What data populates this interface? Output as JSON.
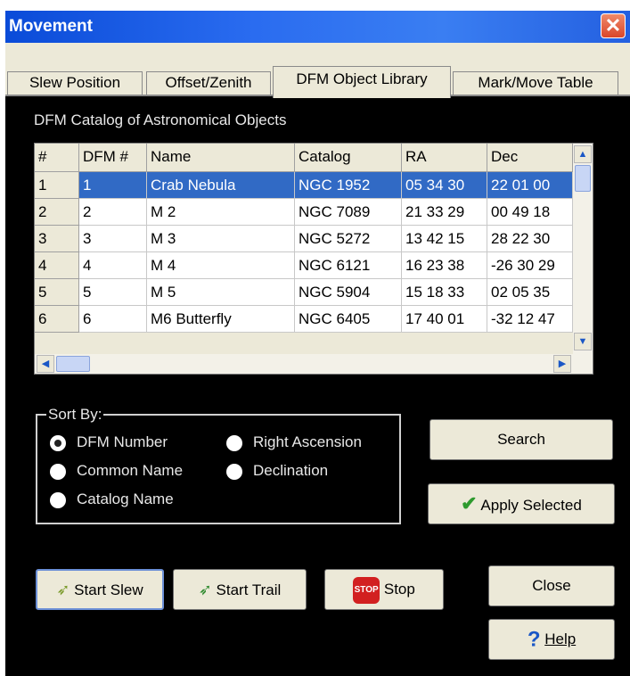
{
  "window": {
    "title": "Movement",
    "close_glyph": "✕"
  },
  "tabs": [
    {
      "label": "Slew Position",
      "active": false
    },
    {
      "label": "Offset/Zenith",
      "active": false
    },
    {
      "label": "DFM Object Library",
      "active": true
    },
    {
      "label": "Mark/Move Table",
      "active": false
    }
  ],
  "catalog": {
    "caption": "DFM Catalog of Astronomical Objects",
    "columns": [
      "#",
      "DFM #",
      "Name",
      "Catalog",
      "RA",
      "Dec"
    ],
    "rows": [
      {
        "num": "1",
        "dfm": "1",
        "name": "Crab Nebula",
        "catalog": "NGC 1952",
        "ra": "05 34 30",
        "dec": "22 01 00",
        "selected": true
      },
      {
        "num": "2",
        "dfm": "2",
        "name": "M 2",
        "catalog": "NGC 7089",
        "ra": "21 33 29",
        "dec": "00 49 18",
        "selected": false
      },
      {
        "num": "3",
        "dfm": "3",
        "name": "M 3",
        "catalog": "NGC 5272",
        "ra": "13 42 15",
        "dec": "28 22 30",
        "selected": false
      },
      {
        "num": "4",
        "dfm": "4",
        "name": "M 4",
        "catalog": "NGC 6121",
        "ra": "16 23 38",
        "dec": "-26 30 29",
        "selected": false
      },
      {
        "num": "5",
        "dfm": "5",
        "name": "M 5",
        "catalog": "NGC 5904",
        "ra": "15 18 33",
        "dec": "02 05 35",
        "selected": false
      },
      {
        "num": "6",
        "dfm": "6",
        "name": "M6 Butterfly",
        "catalog": "NGC 6405",
        "ra": "17 40 01",
        "dec": "-32 12 47",
        "selected": false
      }
    ]
  },
  "sort": {
    "label": "Sort By:",
    "selected": "DFM Number",
    "options": [
      "DFM Number",
      "Common Name",
      "Catalog Name",
      "Right Ascension",
      "Declination"
    ]
  },
  "buttons": {
    "search": "Search",
    "apply": "Apply Selected",
    "start_slew": "Start Slew",
    "start_trail": "Start Trail",
    "stop": "Stop",
    "stop_sign": "STOP",
    "close": "Close",
    "help": "Help",
    "help_glyph": "?"
  },
  "colors": {
    "selection": "#316ac5",
    "dialog_bg": "#000000",
    "control_bg": "#ece9d8",
    "titlebar": "#0a4bd8"
  }
}
